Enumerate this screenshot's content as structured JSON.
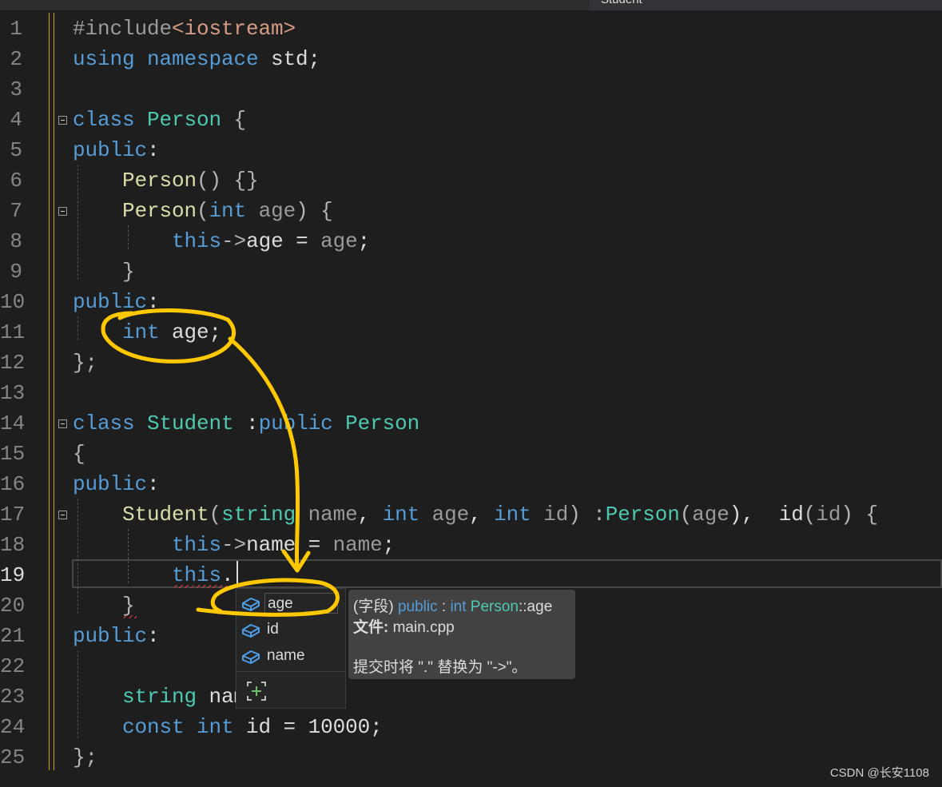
{
  "editor": {
    "nav_label": "Student",
    "current_line": 19,
    "lines": [
      [
        [
          "#include",
          "pp"
        ],
        [
          "<iostream>",
          "st"
        ]
      ],
      [
        [
          "using ",
          "kw"
        ],
        [
          "namespace ",
          "kw"
        ],
        [
          "std;",
          "pl"
        ]
      ],
      [],
      [
        [
          "class ",
          "kw"
        ],
        [
          "Person ",
          "ty"
        ],
        [
          "{",
          "pu"
        ]
      ],
      [
        [
          "public",
          "kw"
        ],
        [
          ":",
          "pl"
        ]
      ],
      [
        [
          "    ",
          ""
        ],
        [
          "Person",
          "fn"
        ],
        [
          "() {}",
          "pu"
        ]
      ],
      [
        [
          "    ",
          ""
        ],
        [
          "Person",
          "fn"
        ],
        [
          "(",
          "pu"
        ],
        [
          "int ",
          "kw"
        ],
        [
          "age",
          "pm"
        ],
        [
          ") {",
          "pu"
        ]
      ],
      [
        [
          "        ",
          ""
        ],
        [
          "this",
          "kw"
        ],
        [
          "->",
          "pu"
        ],
        [
          "age = ",
          "pl"
        ],
        [
          "age",
          "pm"
        ],
        [
          ";",
          "pl"
        ]
      ],
      [
        [
          "    ",
          ""
        ],
        [
          "}",
          "pu"
        ]
      ],
      [
        [
          "public",
          "kw"
        ],
        [
          ":",
          "pl"
        ]
      ],
      [
        [
          "    ",
          ""
        ],
        [
          "int ",
          "kw"
        ],
        [
          "age;",
          "pl"
        ]
      ],
      [
        [
          "};",
          "pu"
        ]
      ],
      [],
      [
        [
          "class ",
          "kw"
        ],
        [
          "Student ",
          "ty"
        ],
        [
          ":",
          "pl"
        ],
        [
          "public ",
          "kw"
        ],
        [
          "Person",
          "ty"
        ]
      ],
      [
        [
          "{",
          "pu"
        ]
      ],
      [
        [
          "public",
          "kw"
        ],
        [
          ":",
          "pl"
        ]
      ],
      [
        [
          "    ",
          ""
        ],
        [
          "Student",
          "fn"
        ],
        [
          "(",
          "pu"
        ],
        [
          "string ",
          "ty"
        ],
        [
          "name",
          "pm"
        ],
        [
          ", ",
          "pl"
        ],
        [
          "int ",
          "kw"
        ],
        [
          "age",
          "pm"
        ],
        [
          ", ",
          "pl"
        ],
        [
          "int ",
          "kw"
        ],
        [
          "id",
          "pm"
        ],
        [
          ") :",
          "pu"
        ],
        [
          "Person",
          "ty"
        ],
        [
          "(",
          "pu"
        ],
        [
          "age",
          "pm"
        ],
        [
          "),  ",
          "pl"
        ],
        [
          "id",
          "pl"
        ],
        [
          "(",
          "pu"
        ],
        [
          "id",
          "pm"
        ],
        [
          ") {",
          "pu"
        ]
      ],
      [
        [
          "        ",
          ""
        ],
        [
          "this",
          "kw"
        ],
        [
          "->",
          "pu"
        ],
        [
          "name",
          "pl"
        ],
        [
          " = ",
          "pl"
        ],
        [
          "name",
          "pm"
        ],
        [
          ";",
          "pl"
        ]
      ],
      [
        [
          "        ",
          ""
        ],
        [
          "this",
          "kw"
        ],
        [
          ".",
          "pl"
        ]
      ],
      [
        [
          "    ",
          ""
        ],
        [
          "}",
          "pu"
        ]
      ],
      [
        [
          "public",
          "kw"
        ],
        [
          ":",
          "pl"
        ]
      ],
      [],
      [
        [
          "    ",
          ""
        ],
        [
          "string ",
          "ty"
        ],
        [
          "name;",
          "pl"
        ]
      ],
      [
        [
          "    ",
          ""
        ],
        [
          "const ",
          "kw"
        ],
        [
          "int ",
          "kw"
        ],
        [
          "id = ",
          "pl"
        ],
        [
          "10000",
          "pl"
        ],
        [
          ";",
          "pl"
        ]
      ],
      [
        [
          "};",
          "pu"
        ]
      ]
    ]
  },
  "completion": {
    "items": [
      {
        "label": "age",
        "icon": "field-icon",
        "selected": true
      },
      {
        "label": "id",
        "icon": "field-icon"
      },
      {
        "label": "name",
        "icon": "field-icon"
      }
    ],
    "filter_icon": "add-filter-icon"
  },
  "tooltip": {
    "kind": "(字段)",
    "access": "public",
    "sep": " : ",
    "type": "int",
    "class_name": "Person",
    "member": "::age",
    "file_label": "文件:",
    "file_name": " main.cpp",
    "hint": "提交时将 \".\" 替换为 \"->\"。"
  },
  "watermark": "CSDN @长安1108",
  "colors": {
    "annotation": "#ffc800",
    "keyword": "#569cd6",
    "type": "#4ec9b0",
    "function": "#dcdcaa"
  }
}
